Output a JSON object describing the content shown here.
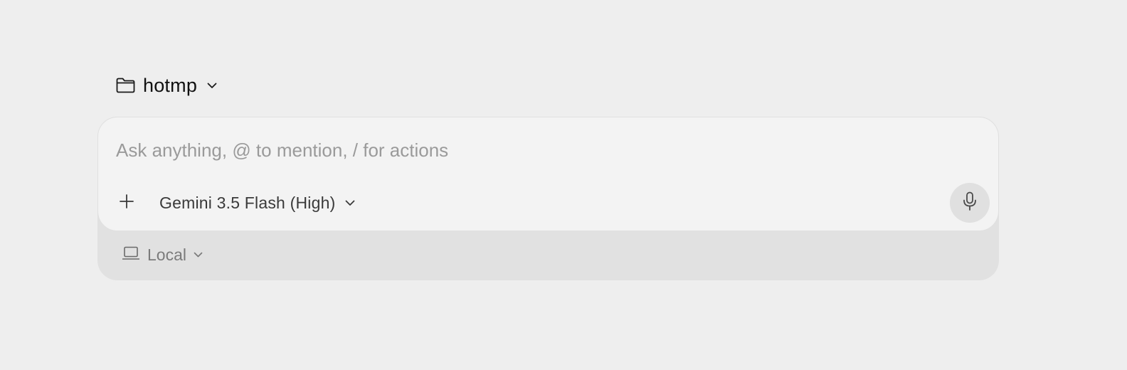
{
  "workspace": {
    "name": "hotmp",
    "icon": "folder-icon",
    "dropdown_icon": "chevron-down-icon"
  },
  "composer": {
    "placeholder": "Ask anything, @ to mention, / for actions",
    "value": "",
    "add_icon": "plus-icon",
    "model": {
      "label": "Gemini 3.5 Flash (High)",
      "dropdown_icon": "chevron-down-icon"
    },
    "mic_icon": "microphone-icon"
  },
  "environment": {
    "label": "Local",
    "icon": "laptop-icon",
    "dropdown_icon": "chevron-down-icon"
  },
  "colors": {
    "page_background": "#eeeeee",
    "composer_background": "#f3f3f3",
    "footer_background": "#e1e1e1",
    "mic_button_background": "#e0e0e0",
    "placeholder_text": "#9a9a9a"
  }
}
